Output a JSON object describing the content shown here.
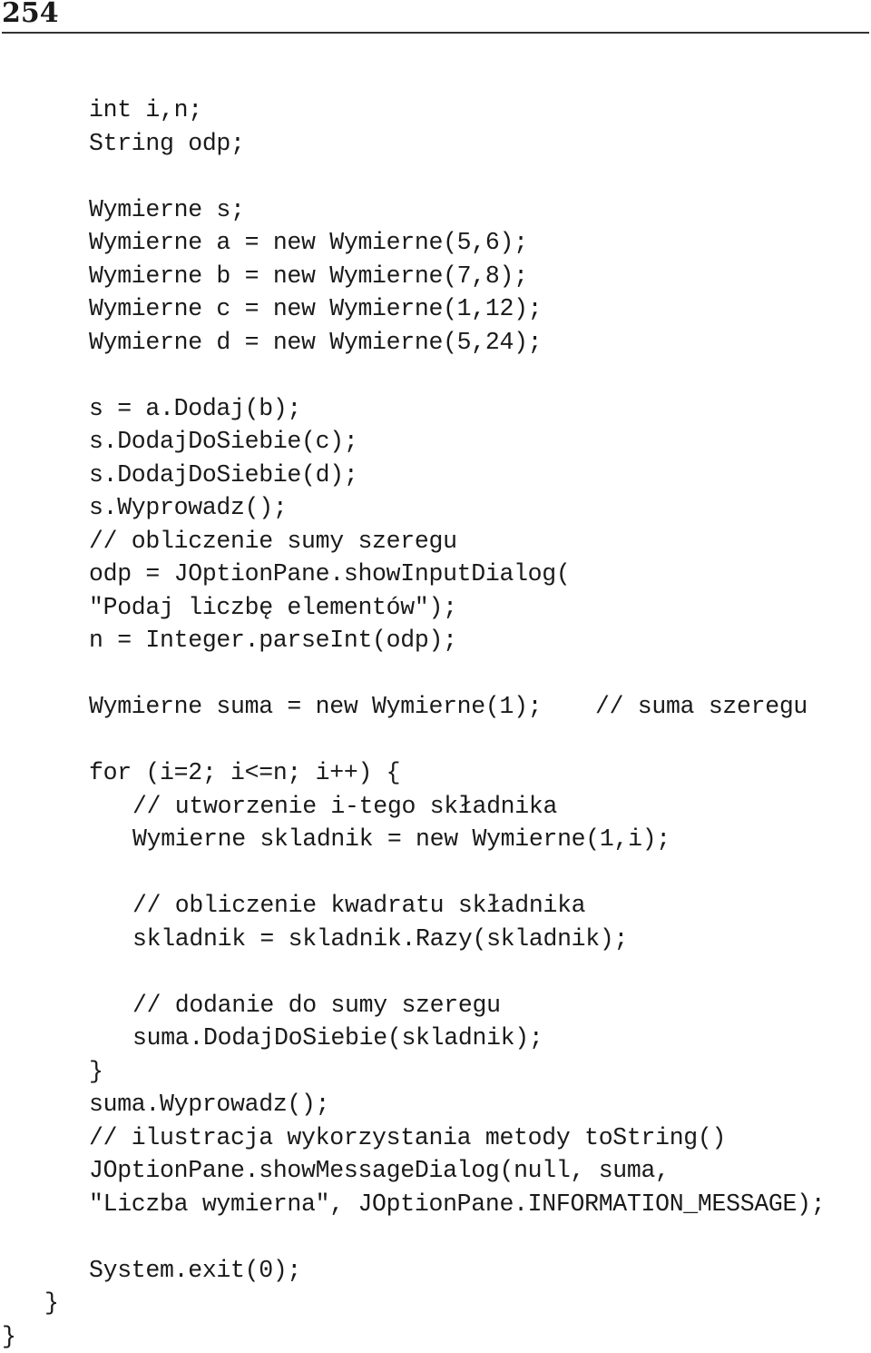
{
  "page": {
    "number": "254"
  },
  "code": {
    "language": "Java",
    "lines": [
      {
        "indent": 2,
        "text": "int i,n;"
      },
      {
        "indent": 2,
        "text": "String odp;"
      },
      {
        "indent": 2,
        "text": ""
      },
      {
        "indent": 2,
        "text": "Wymierne s;"
      },
      {
        "indent": 2,
        "text": "Wymierne a = new Wymierne(5,6);"
      },
      {
        "indent": 2,
        "text": "Wymierne b = new Wymierne(7,8);"
      },
      {
        "indent": 2,
        "text": "Wymierne c = new Wymierne(1,12);"
      },
      {
        "indent": 2,
        "text": "Wymierne d = new Wymierne(5,24);"
      },
      {
        "indent": 2,
        "text": ""
      },
      {
        "indent": 2,
        "text": "s = a.Dodaj(b);"
      },
      {
        "indent": 2,
        "text": "s.DodajDoSiebie(c);"
      },
      {
        "indent": 2,
        "text": "s.DodajDoSiebie(d);"
      },
      {
        "indent": 2,
        "text": "s.Wyprowadz();"
      },
      {
        "indent": 2,
        "text": "// obliczenie sumy szeregu"
      },
      {
        "indent": 2,
        "text": "odp = JOptionPane.showInputDialog("
      },
      {
        "indent": 2,
        "text": "\"Podaj liczbę elementów\");"
      },
      {
        "indent": 2,
        "text": "n = Integer.parseInt(odp);"
      },
      {
        "indent": 2,
        "text": ""
      },
      {
        "indent": 2,
        "text": "Wymierne suma = new Wymierne(1);",
        "comment": "// suma szeregu"
      },
      {
        "indent": 2,
        "text": ""
      },
      {
        "indent": 2,
        "text": "for (i=2; i<=n; i++) {"
      },
      {
        "indent": 3,
        "text": "// utworzenie i-tego składnika"
      },
      {
        "indent": 3,
        "text": "Wymierne skladnik = new Wymierne(1,i);"
      },
      {
        "indent": 3,
        "text": ""
      },
      {
        "indent": 3,
        "text": "// obliczenie kwadratu składnika"
      },
      {
        "indent": 3,
        "text": "skladnik = skladnik.Razy(skladnik);"
      },
      {
        "indent": 3,
        "text": ""
      },
      {
        "indent": 3,
        "text": "// dodanie do sumy szeregu"
      },
      {
        "indent": 3,
        "text": "suma.DodajDoSiebie(skladnik);"
      },
      {
        "indent": 2,
        "text": "}"
      },
      {
        "indent": 2,
        "text": "suma.Wyprowadz();"
      },
      {
        "indent": 2,
        "text": "// ilustracja wykorzystania metody toString()"
      },
      {
        "indent": 2,
        "text": "JOptionPane.showMessageDialog(null, suma,"
      },
      {
        "indent": 2,
        "text": "\"Liczba wymierna\", JOptionPane.INFORMATION_MESSAGE);"
      },
      {
        "indent": 2,
        "text": ""
      },
      {
        "indent": 2,
        "text": "System.exit(0);"
      },
      {
        "indent": 1,
        "text": "}"
      },
      {
        "indent": 0,
        "text": "}"
      }
    ]
  }
}
